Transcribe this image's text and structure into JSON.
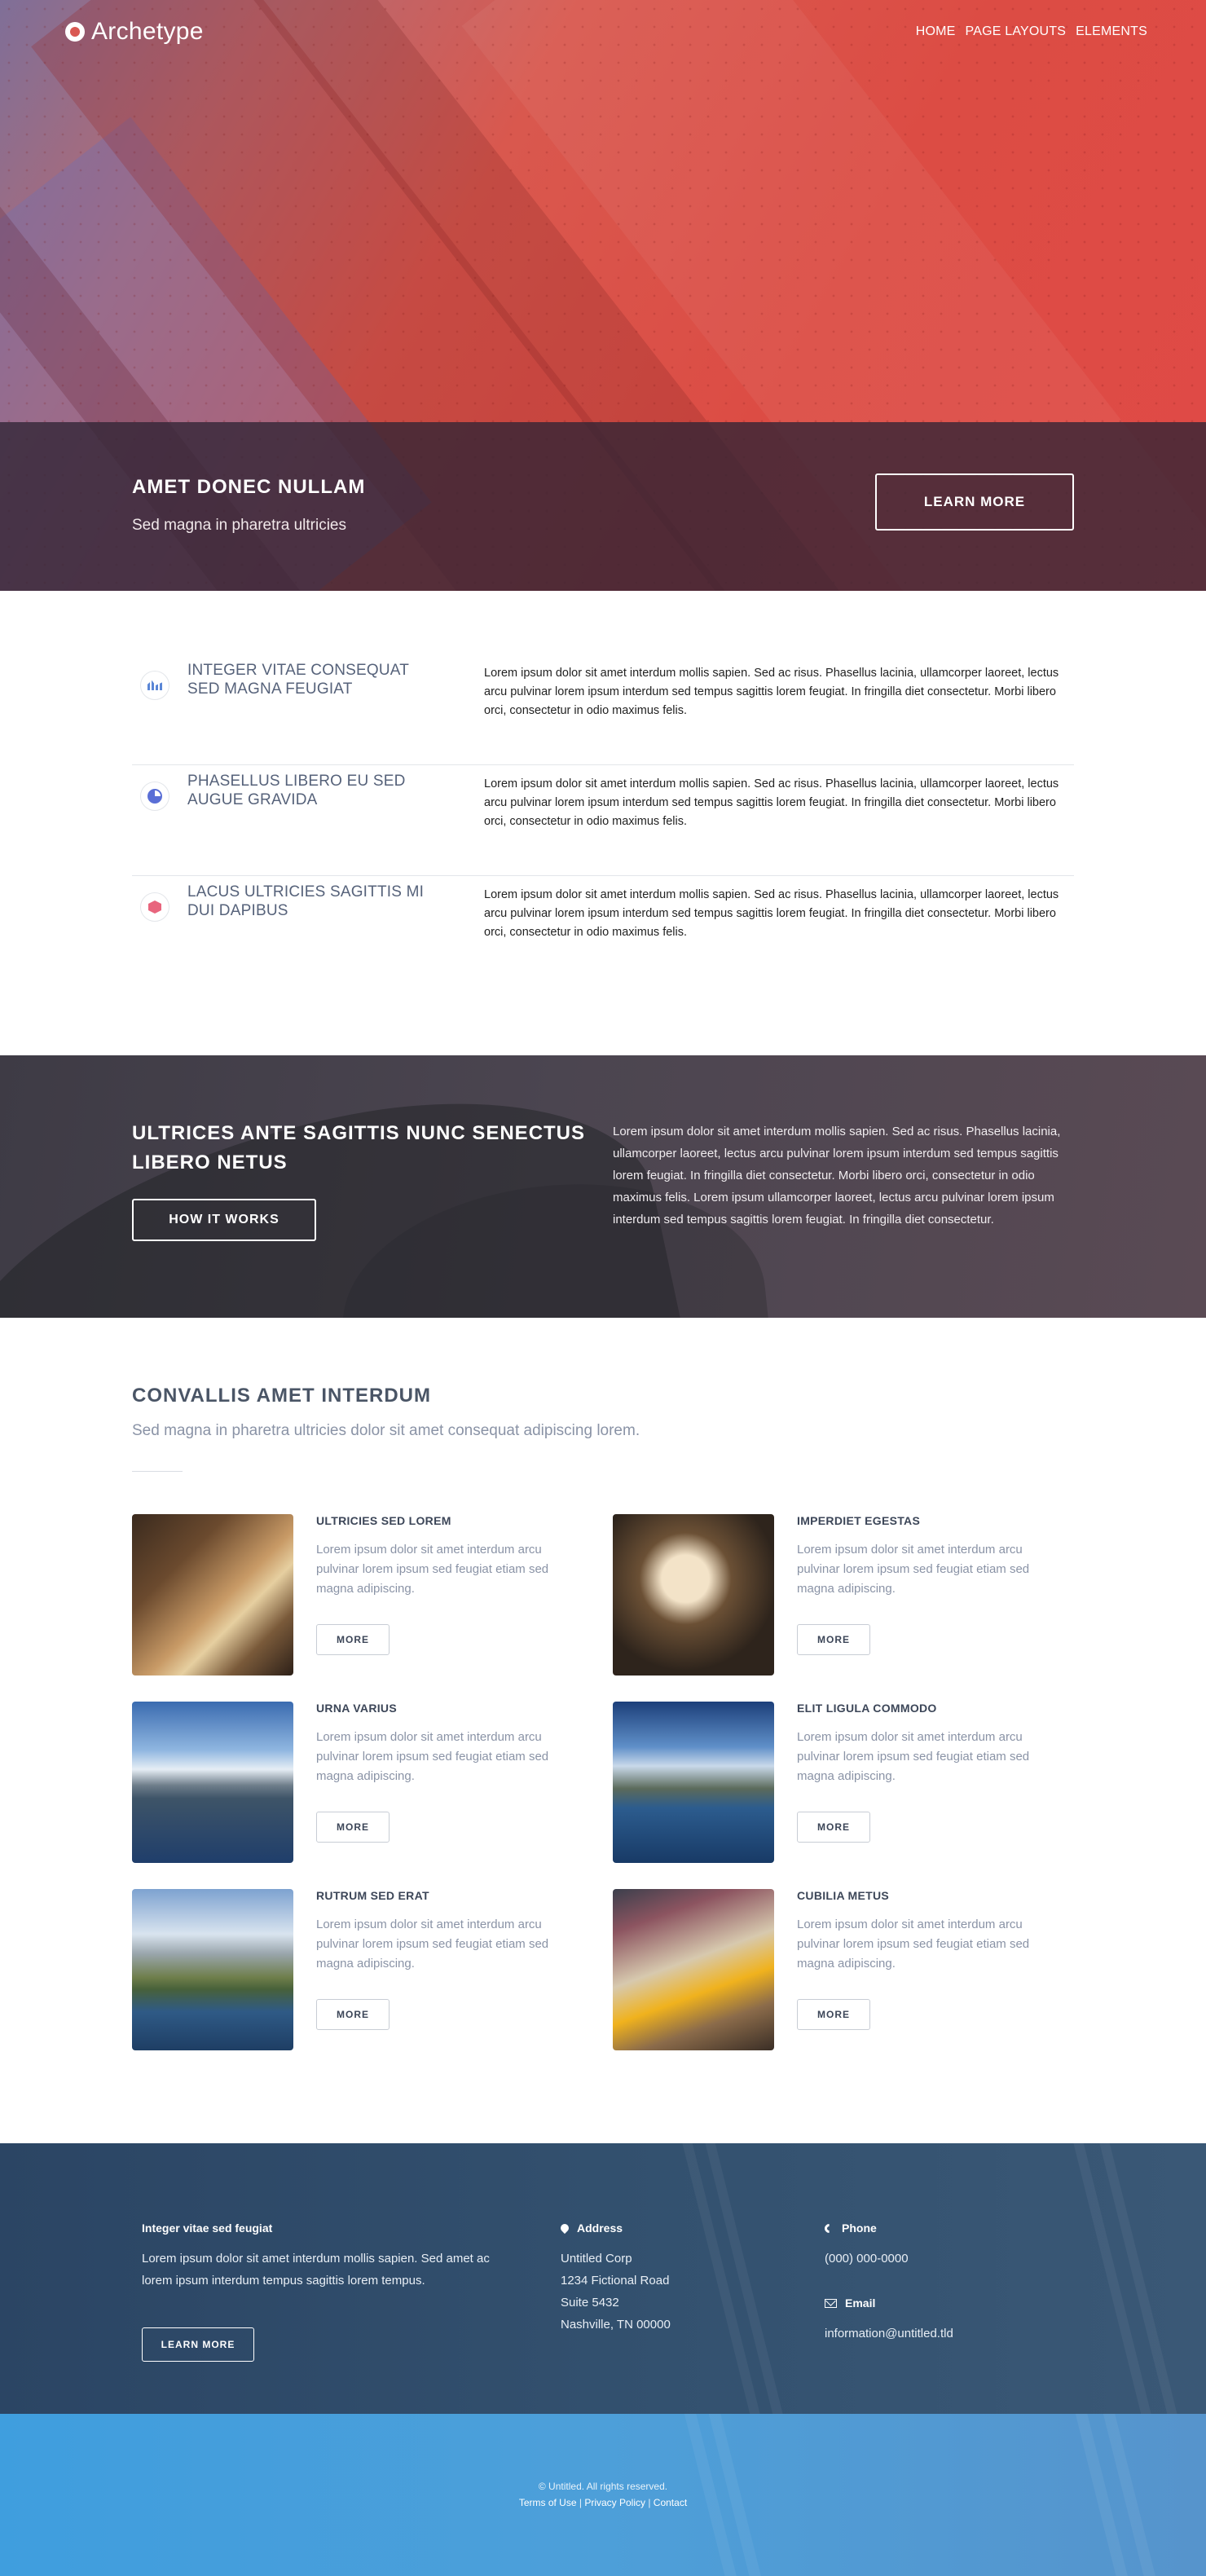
{
  "header": {
    "brand": "Archetype",
    "nav": [
      "HOME",
      "PAGE LAYOUTS",
      "ELEMENTS"
    ]
  },
  "banner": {
    "title": "AMET DONEC NULLAM",
    "subtitle": "Sed magna in pharetra ultricies",
    "button": "LEARN MORE"
  },
  "features": [
    {
      "icon": "area-chart-icon",
      "title": "INTEGER VITAE CONSEQUAT SED MAGNA FEUGIAT",
      "text": "Lorem ipsum dolor sit amet interdum mollis sapien. Sed ac risus. Phasellus lacinia, ullamcorper laoreet, lectus arcu pulvinar lorem ipsum interdum sed tempus sagittis lorem feugiat. In fringilla diet consectetur. Morbi libero orci, consectetur in odio maximus felis."
    },
    {
      "icon": "pie-chart-icon",
      "title": "PHASELLUS LIBERO EU SED AUGUE GRAVIDA",
      "text": "Lorem ipsum dolor sit amet interdum mollis sapien. Sed ac risus. Phasellus lacinia, ullamcorper laoreet, lectus arcu pulvinar lorem ipsum interdum sed tempus sagittis lorem feugiat. In fringilla diet consectetur. Morbi libero orci, consectetur in odio maximus felis."
    },
    {
      "icon": "cube-icon",
      "title": "LACUS ULTRICIES SAGITTIS MI DUI DAPIBUS",
      "text": "Lorem ipsum dolor sit amet interdum mollis sapien. Sed ac risus. Phasellus lacinia, ullamcorper laoreet, lectus arcu pulvinar lorem ipsum interdum sed tempus sagittis lorem feugiat. In fringilla diet consectetur. Morbi libero orci, consectetur in odio maximus felis."
    }
  ],
  "how": {
    "title": "ULTRICES ANTE SAGITTIS NUNC SENECTUS LIBERO NETUS",
    "button": "HOW IT WORKS",
    "text": "Lorem ipsum dolor sit amet interdum mollis sapien. Sed ac risus. Phasellus lacinia, ullamcorper laoreet, lectus arcu pulvinar lorem ipsum interdum sed tempus sagittis lorem feugiat. In fringilla diet consectetur. Morbi libero orci, consectetur in odio maximus felis. Lorem ipsum ullamcorper laoreet, lectus arcu pulvinar lorem ipsum interdum sed tempus sagittis lorem feugiat. In fringilla diet consectetur."
  },
  "convallis": {
    "title": "CONVALLIS AMET INTERDUM",
    "lead": "Sed magna in pharetra ultricies dolor sit amet consequat adipiscing lorem.",
    "cards": [
      {
        "title": "ULTRICIES SED LOREM",
        "text": "Lorem ipsum dolor sit amet interdum arcu pulvinar lorem ipsum sed feugiat etiam sed magna adipiscing.",
        "button": "MORE"
      },
      {
        "title": "IMPERDIET EGESTAS",
        "text": "Lorem ipsum dolor sit amet interdum arcu pulvinar lorem ipsum sed feugiat etiam sed magna adipiscing.",
        "button": "MORE"
      },
      {
        "title": "URNA VARIUS",
        "text": "Lorem ipsum dolor sit amet interdum arcu pulvinar lorem ipsum sed feugiat etiam sed magna adipiscing.",
        "button": "MORE"
      },
      {
        "title": "ELIT LIGULA COMMODO",
        "text": "Lorem ipsum dolor sit amet interdum arcu pulvinar lorem ipsum sed feugiat etiam sed magna adipiscing.",
        "button": "MORE"
      },
      {
        "title": "RUTRUM SED ERAT",
        "text": "Lorem ipsum dolor sit amet interdum arcu pulvinar lorem ipsum sed feugiat etiam sed magna adipiscing.",
        "button": "MORE"
      },
      {
        "title": "CUBILIA METUS",
        "text": "Lorem ipsum dolor sit amet interdum arcu pulvinar lorem ipsum sed feugiat etiam sed magna adipiscing.",
        "button": "MORE"
      }
    ]
  },
  "footer": {
    "about_title": "Integer vitae sed feugiat",
    "about_text": "Lorem ipsum dolor sit amet interdum mollis sapien. Sed amet ac lorem ipsum interdum tempus sagittis lorem tempus.",
    "about_button": "LEARN MORE",
    "address_title": "Address",
    "address_lines": [
      "Untitled Corp",
      "1234 Fictional Road",
      "Suite 5432",
      "Nashville, TN 00000"
    ],
    "phone_title": "Phone",
    "phone": "(000) 000-0000",
    "email_title": "Email",
    "email": "information@untitled.tld"
  },
  "copyright": {
    "text": "© Untitled. All rights reserved.",
    "links": [
      "Terms of Use",
      "Privacy Policy",
      "Contact"
    ],
    "separator": " | "
  },
  "colors": {
    "hero_red": "#dc4c44",
    "banner_overlay": "#302434",
    "footer_navy": "#2f4b6a",
    "copyright_blue": "#4d9fd9",
    "text_gray": "#8a93a6"
  }
}
